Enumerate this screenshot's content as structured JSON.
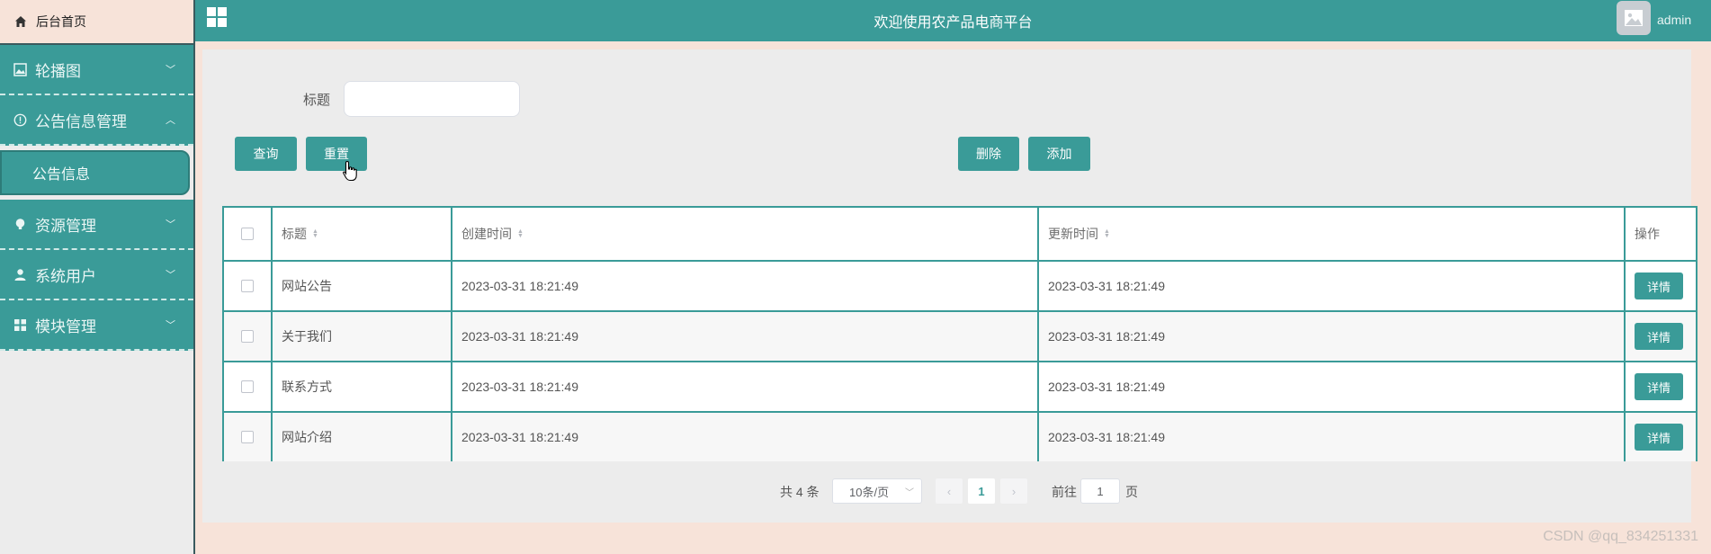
{
  "sidebar": {
    "home": "后台首页",
    "menus": [
      {
        "label": "轮播图",
        "icon": "image-icon",
        "expanded": false
      },
      {
        "label": "公告信息管理",
        "icon": "info-circle-icon",
        "expanded": true
      },
      {
        "label": "资源管理",
        "icon": "bulb-icon",
        "expanded": false
      },
      {
        "label": "系统用户",
        "icon": "user-icon",
        "expanded": false
      },
      {
        "label": "模块管理",
        "icon": "grid-icon",
        "expanded": false
      }
    ],
    "submenu_active": "公告信息"
  },
  "header": {
    "title": "欢迎使用农产品电商平台",
    "user": "admin"
  },
  "search": {
    "label": "标题",
    "value": "",
    "query_button": "查询",
    "reset_button": "重置",
    "delete_button": "删除",
    "add_button": "添加"
  },
  "table": {
    "columns": [
      "标题",
      "创建时间",
      "更新时间",
      "操作"
    ],
    "rows": [
      {
        "title": "网站公告",
        "created": "2023-03-31 18:21:49",
        "updated": "2023-03-31 18:21:49",
        "action": "详情"
      },
      {
        "title": "关于我们",
        "created": "2023-03-31 18:21:49",
        "updated": "2023-03-31 18:21:49",
        "action": "详情"
      },
      {
        "title": "联系方式",
        "created": "2023-03-31 18:21:49",
        "updated": "2023-03-31 18:21:49",
        "action": "详情"
      },
      {
        "title": "网站介绍",
        "created": "2023-03-31 18:21:49",
        "updated": "2023-03-31 18:21:49",
        "action": "详情"
      }
    ]
  },
  "pagination": {
    "total": "共 4 条",
    "page_size": "10条/页",
    "current_page": "1",
    "prev": "‹",
    "next": "›",
    "goto_prefix": "前往",
    "goto_value": "1",
    "goto_suffix": "页"
  },
  "watermark": "CSDN @qq_834251331",
  "colors": {
    "primary": "#3a9b98",
    "background": "#f7e3d9",
    "panel": "#ececec"
  }
}
